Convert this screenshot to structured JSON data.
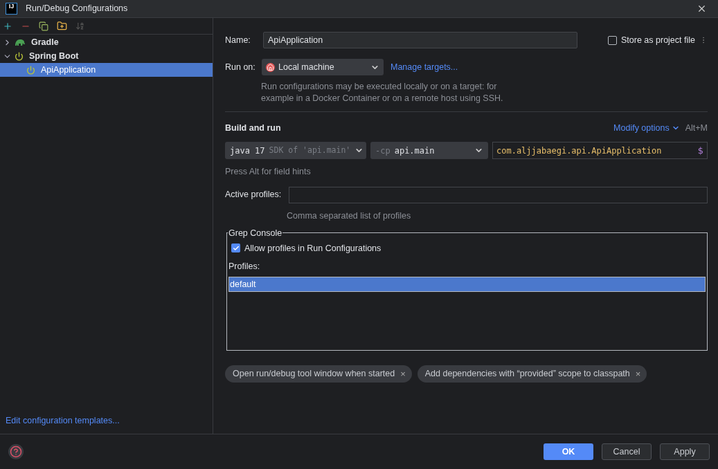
{
  "window": {
    "title": "Run/Debug Configurations",
    "logo": "IJ"
  },
  "tree": [
    {
      "label": "Gradle",
      "kind": "gradle",
      "expanded": false,
      "selected": false
    },
    {
      "label": "Spring Boot",
      "kind": "spring",
      "expanded": true,
      "selected": false,
      "children": [
        {
          "label": "ApiApplication",
          "kind": "spring",
          "selected": true
        }
      ]
    }
  ],
  "edit_templates_link": "Edit configuration templates...",
  "name_field": {
    "label": "Name:",
    "value": "ApiApplication"
  },
  "store_as_project_file": {
    "label": "Store as project file",
    "checked": false
  },
  "run_on": {
    "label": "Run on:",
    "value": "Local machine",
    "link": "Manage targets...",
    "hint": "Run configurations may be executed locally or on a target: for example in a Docker Container or on a remote host using SSH."
  },
  "build_and_run": {
    "title": "Build and run",
    "modify_options": "Modify options",
    "shortcut": "Alt+M",
    "jdk": {
      "name": "java 17",
      "detail": "SDK of 'api.main'"
    },
    "classpath": {
      "prefix": "-cp",
      "value": "api.main"
    },
    "main_class": {
      "value": "com.aljjabaegi.api.ApiApplication",
      "macro": "$"
    },
    "hint": "Press Alt for field hints"
  },
  "active_profiles": {
    "label": "Active profiles:",
    "hint": "Comma separated list of profiles"
  },
  "grep_console": {
    "title": "Grep Console",
    "allow_profiles": {
      "label": "Allow profiles in Run Configurations",
      "checked": true
    },
    "profiles_label": "Profiles:",
    "profiles": [
      {
        "label": "default",
        "selected": true
      }
    ]
  },
  "options": [
    {
      "label": "Open run/debug tool window when started",
      "close": "×"
    },
    {
      "label": "Add dependencies with “provided” scope to classpath",
      "close": "×"
    }
  ],
  "buttons": [
    {
      "label": "OK",
      "kind": "primary"
    },
    {
      "label": "Cancel",
      "kind": "secondary"
    },
    {
      "label": "Apply",
      "kind": "secondary"
    }
  ]
}
